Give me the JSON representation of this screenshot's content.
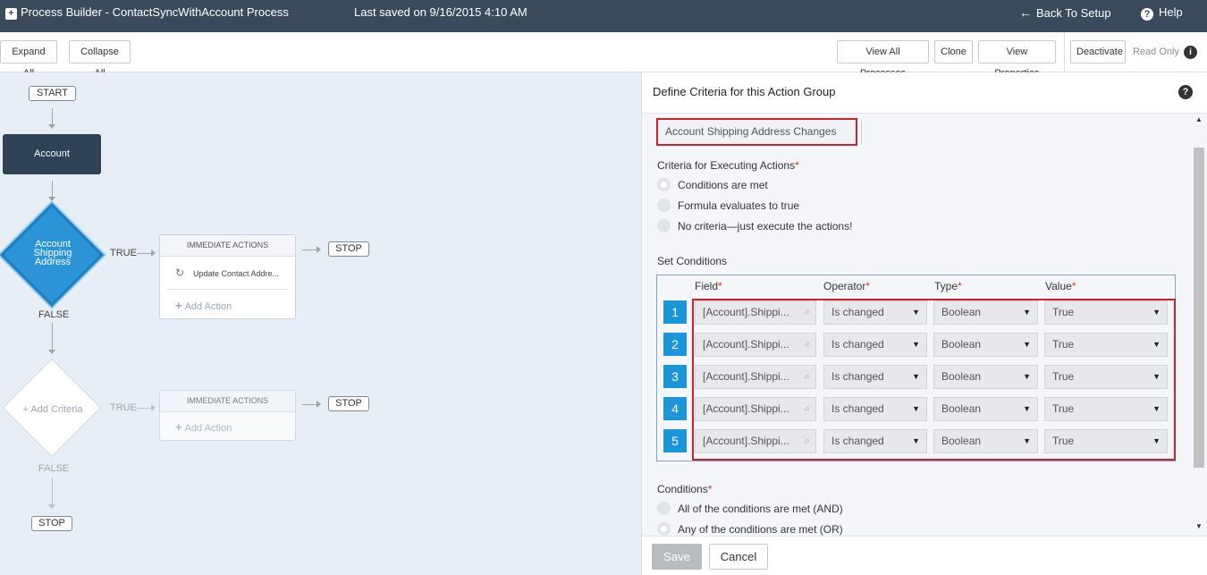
{
  "header": {
    "app_icon": "plus-box-icon",
    "title": "Process Builder - ContactSyncWithAccount Process",
    "last_saved": "Last saved on 9/16/2015 4:10 AM",
    "back_label": "Back To Setup",
    "help_label": "Help"
  },
  "toolbar": {
    "expand_all": "Expand All",
    "collapse_all": "Collapse All",
    "view_all_processes": "View All Processes",
    "clone": "Clone",
    "view_properties": "View Properties",
    "deactivate": "Deactivate",
    "read_only": "Read Only"
  },
  "canvas": {
    "start": "START",
    "account_node": "Account",
    "criteria_node": "Account Shipping Address",
    "true_label": "TRUE",
    "false_label": "FALSE",
    "immediate_actions": "IMMEDIATE ACTIONS",
    "action_item": "Update Contact Addre...",
    "add_action": "Add Action",
    "stop": "STOP",
    "add_criteria": "Add Criteria"
  },
  "panel": {
    "title": "Define Criteria for this Action Group",
    "criteria_name": "Account Shipping Address Changes",
    "criteria_for_executing": "Criteria for Executing Actions",
    "options": [
      "Conditions are met",
      "Formula evaluates to true",
      "No criteria—just execute the actions!"
    ],
    "set_conditions": "Set Conditions",
    "columns": {
      "field": "Field",
      "operator": "Operator",
      "type": "Type",
      "value": "Value"
    },
    "rows": [
      {
        "num": "1",
        "field": "[Account].Shippi...",
        "operator": "Is changed",
        "type": "Boolean",
        "value": "True"
      },
      {
        "num": "2",
        "field": "[Account].Shippi...",
        "operator": "Is changed",
        "type": "Boolean",
        "value": "True"
      },
      {
        "num": "3",
        "field": "[Account].Shippi...",
        "operator": "Is changed",
        "type": "Boolean",
        "value": "True"
      },
      {
        "num": "4",
        "field": "[Account].Shippi...",
        "operator": "Is changed",
        "type": "Boolean",
        "value": "True"
      },
      {
        "num": "5",
        "field": "[Account].Shippi...",
        "operator": "Is changed",
        "type": "Boolean",
        "value": "True"
      }
    ],
    "conditions_label": "Conditions",
    "condition_options": [
      "All of the conditions are met (AND)",
      "Any of the conditions are met (OR)"
    ],
    "save": "Save",
    "cancel": "Cancel"
  },
  "colors": {
    "header_bg": "#3b4a5a",
    "accent_blue": "#2a94d6",
    "highlight_red": "#d0202e"
  }
}
